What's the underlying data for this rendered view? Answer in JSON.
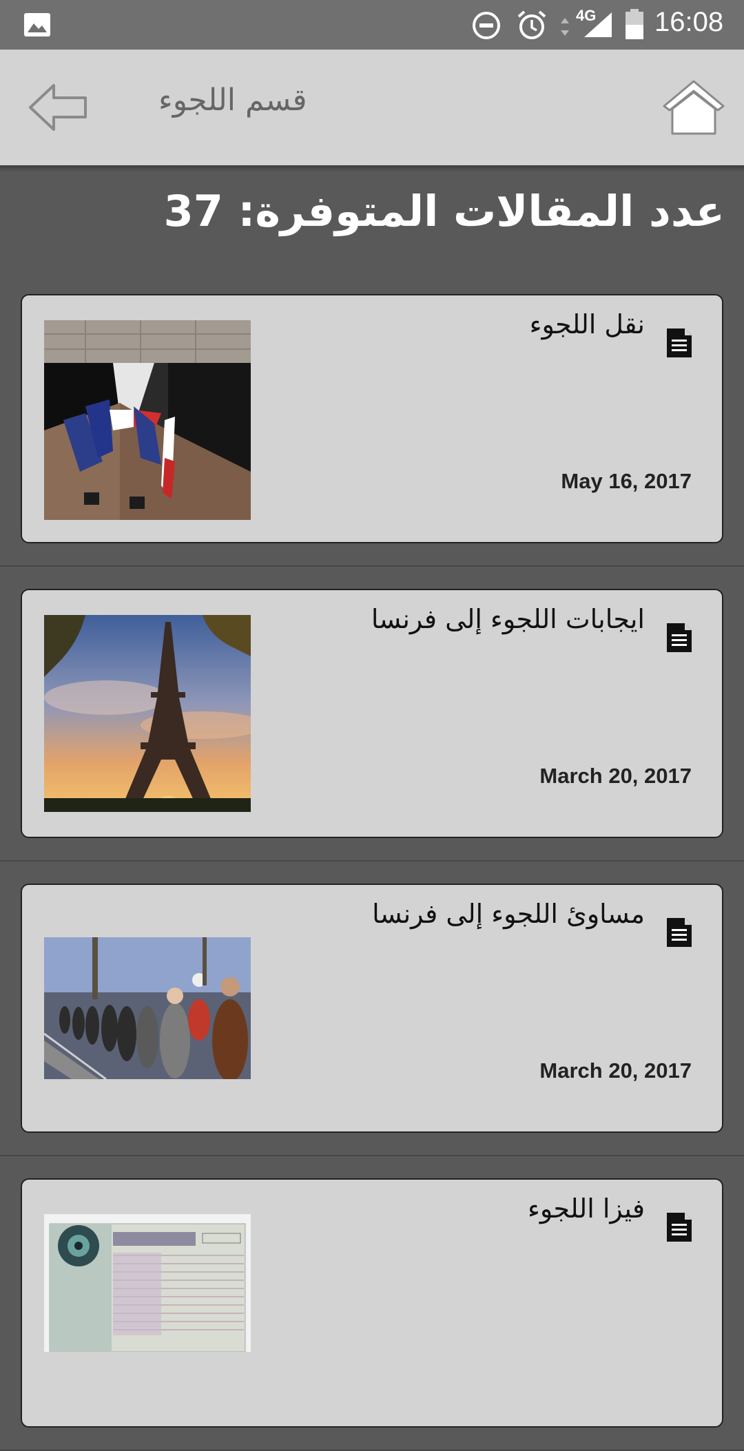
{
  "status_bar": {
    "time": "16:08",
    "network": "4G",
    "icons": [
      "gallery-icon",
      "do-not-disturb-icon",
      "alarm-icon",
      "data-arrows-icon",
      "signal-icon",
      "battery-icon"
    ]
  },
  "app_bar": {
    "title": "قسم اللجوء",
    "back_icon": "back-arrow-icon",
    "home_icon": "home-icon"
  },
  "count_heading": "عدد المقالات المتوفرة: 37",
  "articles": [
    {
      "title": "نقل اللجوء",
      "date": "May 16, 2017",
      "image": "french-eu-flags-on-building",
      "icon": "document-icon"
    },
    {
      "title": "ايجابات اللجوء إلى فرنسا",
      "date": "March 20, 2017",
      "image": "eiffel-tower-sunset",
      "icon": "document-icon"
    },
    {
      "title": "مساوئ اللجوء إلى فرنسا",
      "date": "March 20, 2017",
      "image": "refugees-walking-along-rails",
      "icon": "document-icon"
    },
    {
      "title": "فيزا اللجوء",
      "date": "",
      "image": "visa-document",
      "icon": "document-icon"
    }
  ],
  "colors": {
    "status_bar": "#707070",
    "app_bar": "#d3d3d3",
    "background": "#595959",
    "card": "#d3d3d3"
  }
}
